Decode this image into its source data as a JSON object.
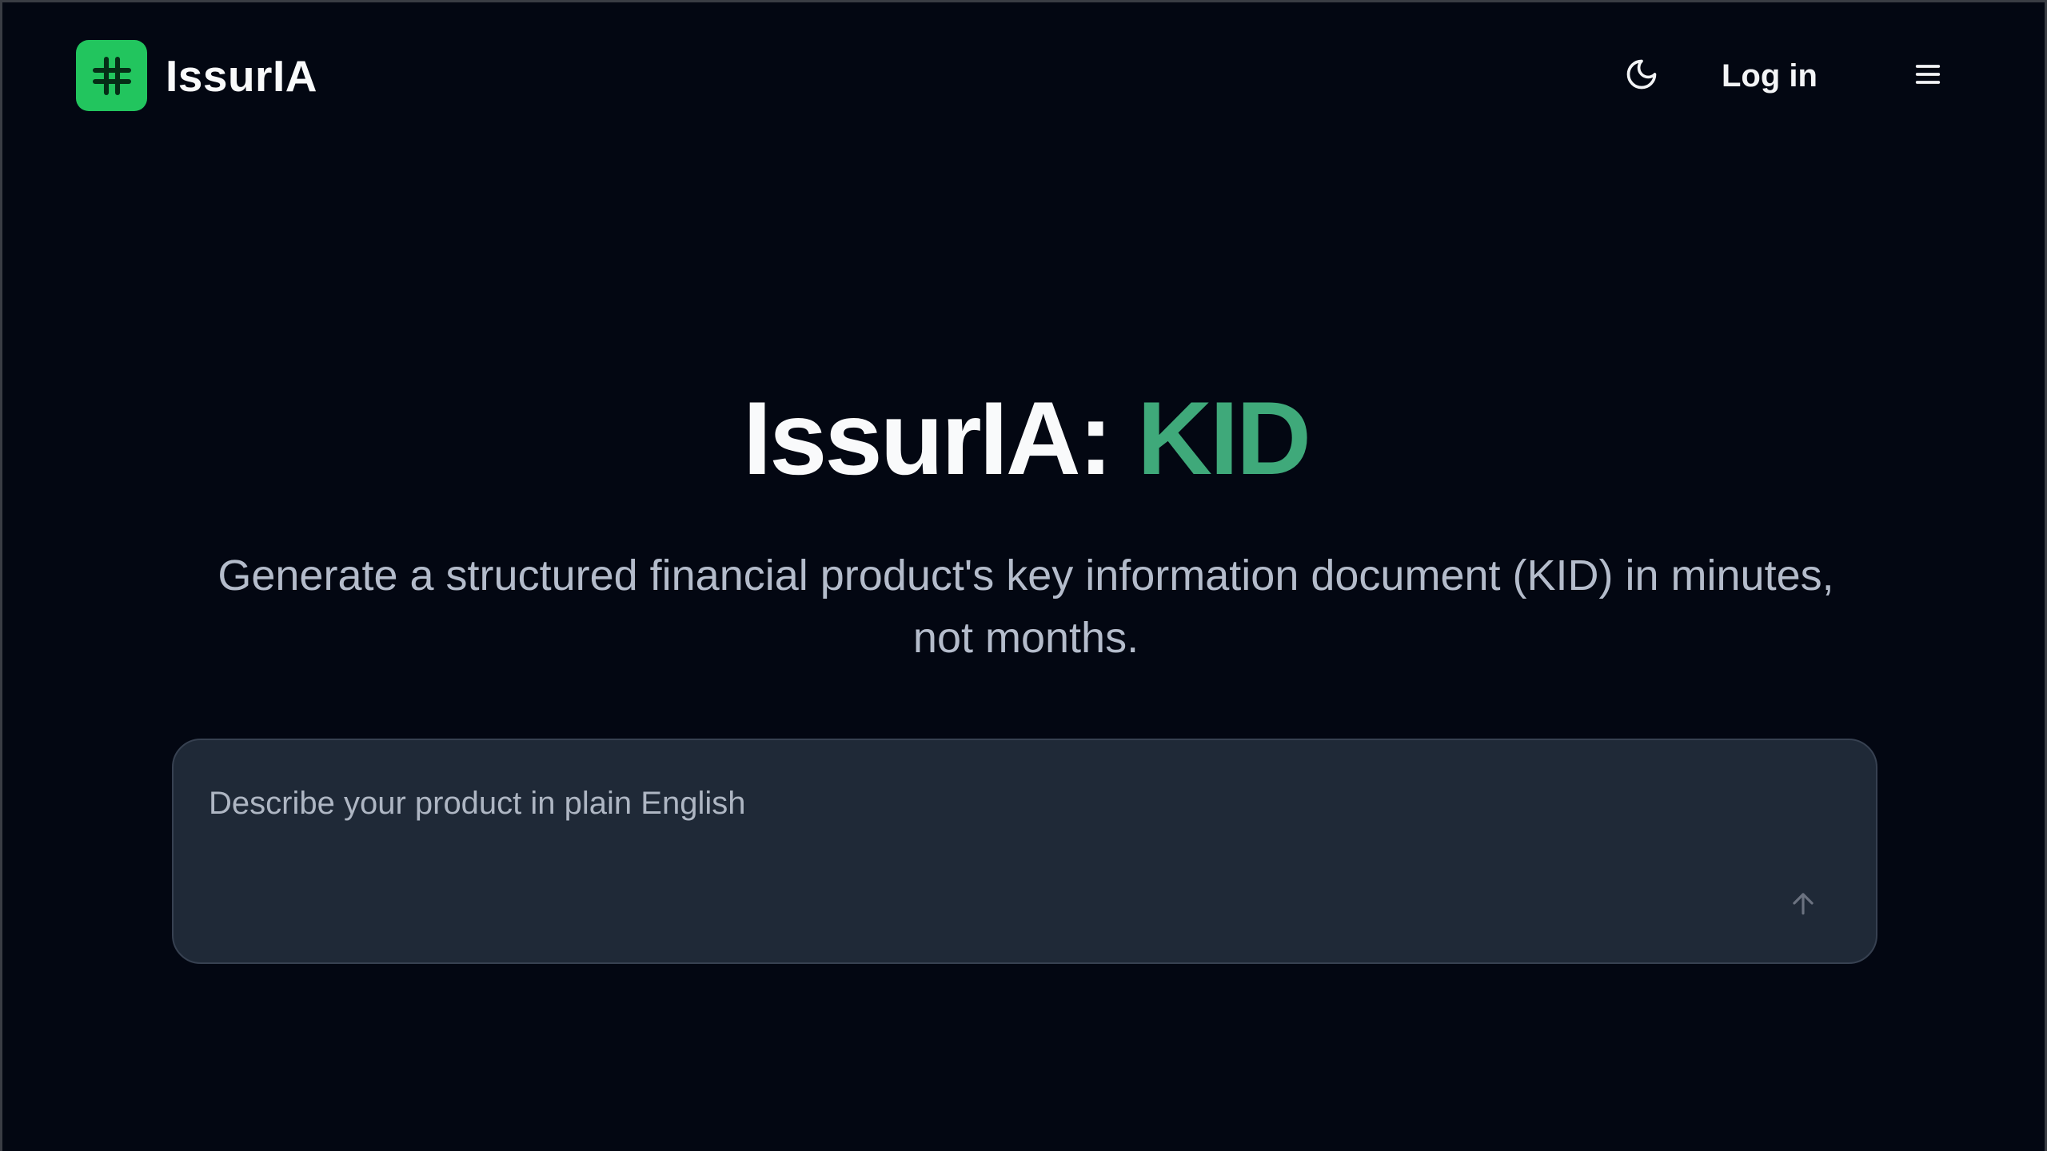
{
  "header": {
    "brand_name": "IssurIA",
    "logo_icon": "hash-icon",
    "theme_toggle_icon": "moon-icon",
    "login_label": "Log in",
    "menu_icon": "hamburger-menu-icon"
  },
  "hero": {
    "title_prefix": "IssurIA: ",
    "title_highlight": "KID",
    "subtitle": "Generate a structured financial product's key information document (KID) in minutes, not months."
  },
  "prompt": {
    "placeholder": "Describe your product in plain English",
    "value": "",
    "send_icon": "arrow-up-icon"
  },
  "colors": {
    "background": "#030712",
    "accent_green": "#22c55e",
    "highlight_green": "#3fa97a",
    "input_background": "#1f2937"
  }
}
